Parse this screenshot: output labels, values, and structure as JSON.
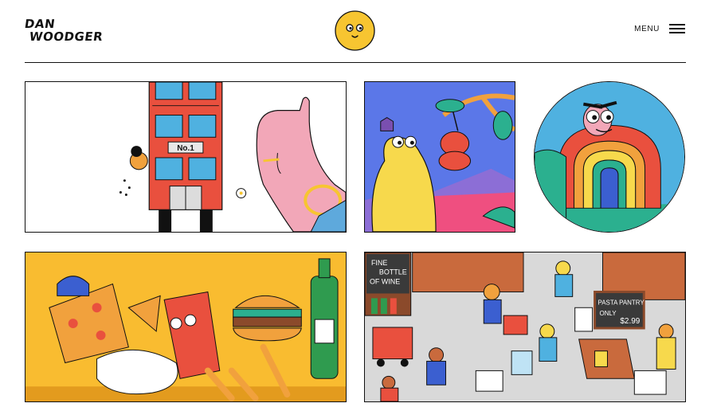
{
  "header": {
    "logo_line1": "DAN",
    "logo_line2": "WOODGER",
    "menu_label": "MENU"
  },
  "tiles": {
    "bus": {
      "plate": "No.1"
    },
    "store": {
      "wine_sign": [
        "FINE",
        "BOTTLE",
        "OF WINE"
      ],
      "chalkboard": [
        "PASTA PANTRY",
        "ONLY",
        "$2.99"
      ]
    }
  },
  "colors": {
    "accent_yellow": "#f7c531",
    "bus_red": "#e9503e",
    "window_blue": "#4fb1e0",
    "cherry_bg": "#5b77e8",
    "food_bg": "#f9bc30",
    "store_bg": "#d9d9d9"
  }
}
